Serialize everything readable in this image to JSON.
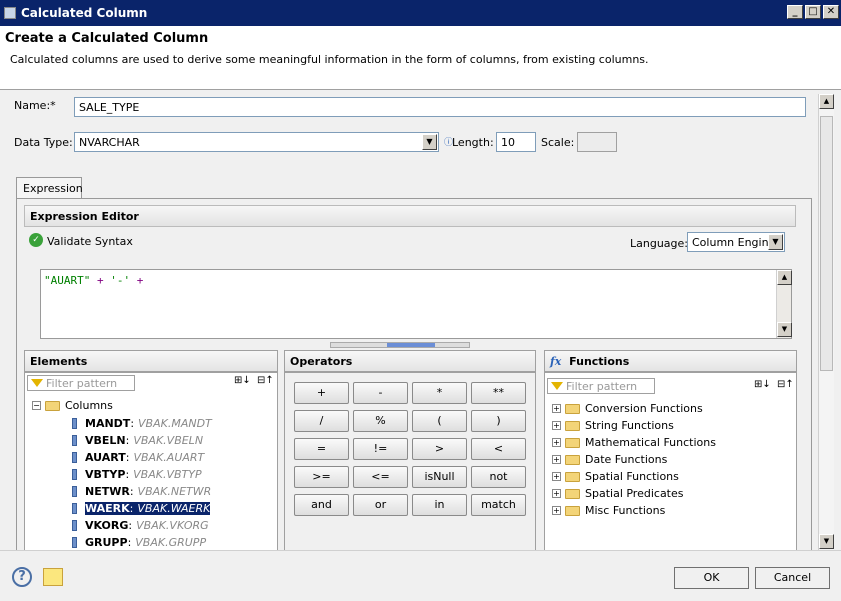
{
  "window": {
    "title": "Calculated Column"
  },
  "header": {
    "title": "Create a Calculated Column",
    "description": "Calculated columns are used to derive some meaningful information in the form of columns, from existing columns."
  },
  "form": {
    "name_label": "Name:*",
    "name_value": "SALE_TYPE",
    "datatype_label": "Data Type:",
    "datatype_value": "NVARCHAR",
    "length_label": "Length:",
    "length_value": "10",
    "scale_label": "Scale:"
  },
  "tab": {
    "label": "Expression"
  },
  "expression_editor": {
    "title": "Expression Editor",
    "validate_label": "Validate Syntax",
    "language_label": "Language:",
    "language_value": "Column Engine",
    "expr_column": "\"AUART\"",
    "expr_op1": "+",
    "expr_string": "'-'",
    "expr_op2": "+"
  },
  "elements": {
    "title": "Elements",
    "filter_placeholder": "Filter pattern",
    "root": "Columns",
    "columns": [
      {
        "name": "MANDT",
        "source": "VBAK.MANDT"
      },
      {
        "name": "VBELN",
        "source": "VBAK.VBELN"
      },
      {
        "name": "AUART",
        "source": "VBAK.AUART"
      },
      {
        "name": "VBTYP",
        "source": "VBAK.VBTYP"
      },
      {
        "name": "NETWR",
        "source": "VBAK.NETWR"
      },
      {
        "name": "WAERK",
        "source": "VBAK.WAERK"
      },
      {
        "name": "VKORG",
        "source": "VBAK.VKORG"
      },
      {
        "name": "GRUPP",
        "source": "VBAK.GRUPP"
      }
    ],
    "sep": ":"
  },
  "operators": {
    "title": "Operators",
    "buttons": [
      "+",
      "-",
      "*",
      "**",
      "/",
      "%",
      "(",
      ")",
      "=",
      "!=",
      ">",
      "<",
      ">=",
      "<=",
      "isNull",
      "not",
      "and",
      "or",
      "in",
      "match"
    ]
  },
  "functions": {
    "title": "Functions",
    "icon_label": "fx",
    "filter_placeholder": "Filter pattern",
    "items": [
      "Conversion Functions",
      "String Functions",
      "Mathematical Functions",
      "Date Functions",
      "Spatial Functions",
      "Spatial Predicates",
      "Misc Functions"
    ]
  },
  "footer": {
    "ok_label": "OK",
    "cancel_label": "Cancel",
    "help_label": "?"
  },
  "colors": {
    "titlebar": "#0a246a",
    "selection": "#0a246a",
    "column_text": "#008000",
    "operator_text": "#800080"
  }
}
